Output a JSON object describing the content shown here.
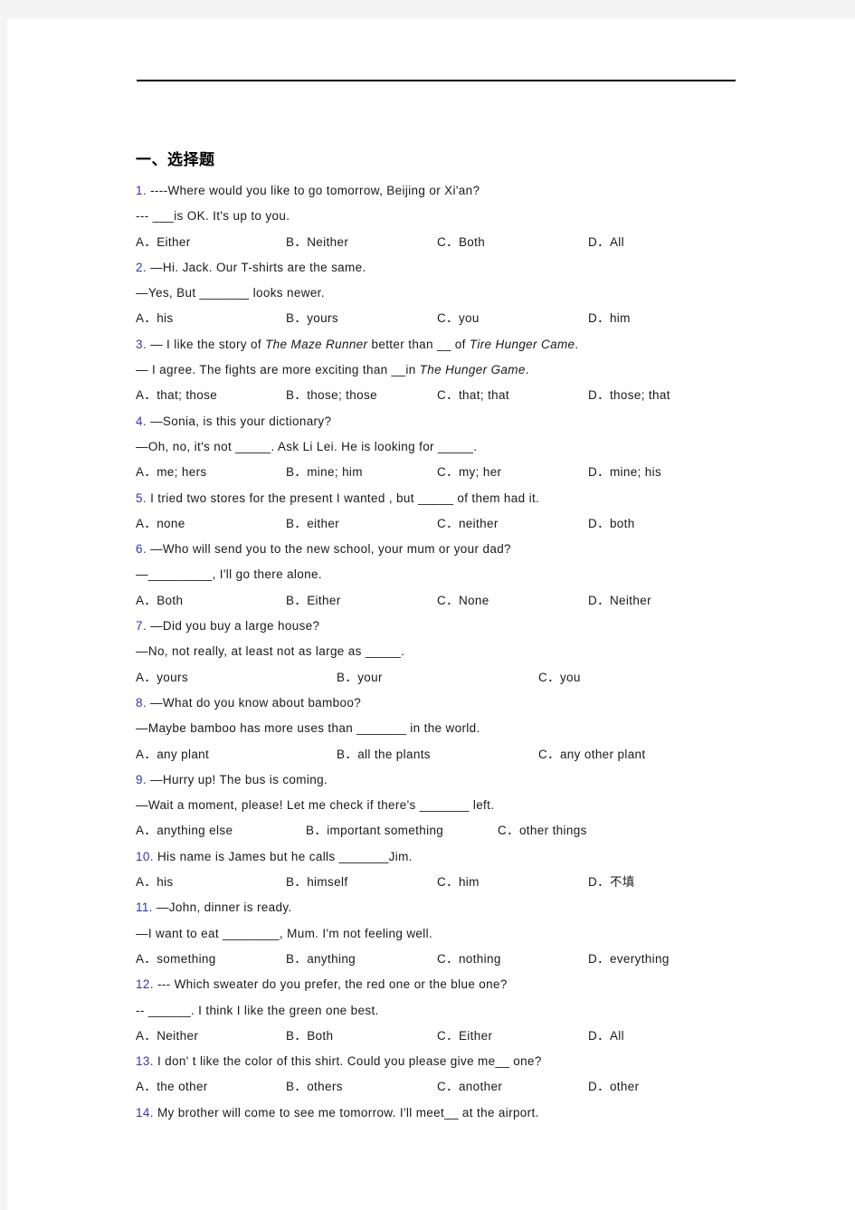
{
  "document": {
    "section_heading": "一、选择题",
    "questions": [
      {
        "num": "1.",
        "lines": [
          "----Where would you like to go tomorrow, Beijing or Xi'an?",
          "--- ___is OK. It's up to you."
        ],
        "options": [
          "A．Either",
          "B．Neither",
          "C．Both",
          "D．All"
        ],
        "layout": "cols4"
      },
      {
        "num": "2.",
        "lines": [
          "—Hi. Jack. Our T-shirts are the same.",
          "—Yes, But _______ looks newer."
        ],
        "options": [
          "A．his",
          "B．yours",
          "C．you",
          "D．him"
        ],
        "layout": "cols4"
      },
      {
        "num": "3.",
        "lines": [
          "— I like the story of The Maze Runner better than  __ of Tire Hunger Came.",
          "— I agree. The fights are more exciting than   __in The Hunger Game."
        ],
        "options": [
          "A．that; those",
          "B．those; those",
          "C．that; that",
          "D．those; that"
        ],
        "layout": "cols4"
      },
      {
        "num": "4.",
        "lines": [
          "—Sonia, is this your dictionary?",
          "—Oh, no, it's not _____. Ask Li Lei. He is looking for _____."
        ],
        "options": [
          "A．me; hers",
          "B．mine; him",
          "C．my; her",
          "D．mine; his"
        ],
        "layout": "cols4"
      },
      {
        "num": "5.",
        "lines": [
          "I tried two stores for the present I wanted , but _____ of them had it."
        ],
        "options": [
          "A．none",
          "B．either",
          "C．neither",
          "D．both"
        ],
        "layout": "cols4"
      },
      {
        "num": "6.",
        "lines": [
          "—Who will send you to the new school, your mum or your dad?",
          "—_________, I'll go there alone."
        ],
        "options": [
          "A．Both",
          "B．Either",
          "C．None",
          "D．Neither"
        ],
        "layout": "cols4"
      },
      {
        "num": "7.",
        "lines": [
          "—Did you buy a large house?",
          "—No, not really, at least not as large as _____."
        ],
        "options": [
          "A．yours",
          "B．your",
          "C．you"
        ],
        "layout": "cols3"
      },
      {
        "num": "8.",
        "lines": [
          "—What do you know about bamboo?",
          "—Maybe bamboo has more uses than _______ in the world."
        ],
        "options": [
          "A．any plant",
          "B．all the plants",
          "C．any other plant"
        ],
        "layout": "cols3"
      },
      {
        "num": "9.",
        "lines": [
          "—Hurry up! The bus is coming.",
          "—Wait a moment, please! Let me check if there's _______ left."
        ],
        "options": [
          "A．anything else",
          "B．important something",
          "C．other things"
        ],
        "layout": "cols3b"
      },
      {
        "num": "10.",
        "lines": [
          "His name is James but he calls _______Jim."
        ],
        "options": [
          "A．his",
          "B．himself",
          "C．him",
          "D．不填"
        ],
        "layout": "cols4"
      },
      {
        "num": "11.",
        "lines": [
          "—John, dinner is ready.",
          "—I want to eat ________, Mum. I'm not feeling well."
        ],
        "options": [
          "A．something",
          "B．anything",
          "C．nothing",
          "D．everything"
        ],
        "layout": "cols4"
      },
      {
        "num": "12.",
        "lines": [
          "--- Which sweater do you prefer, the red one or the blue one?",
          "-- ______. I think I like the green one best."
        ],
        "options": [
          "A．Neither",
          "B．Both",
          "C．Either",
          "D．All"
        ],
        "layout": "cols4"
      },
      {
        "num": "13.",
        "lines": [
          "I don' t like the color of this shirt. Could you please give me__ one?"
        ],
        "options": [
          "A．the other",
          "B．others",
          "C．another",
          "D．other"
        ],
        "layout": "cols4"
      },
      {
        "num": "14.",
        "lines": [
          "My brother will come to see me tomorrow. I'll meet__ at the airport."
        ],
        "options": [],
        "layout": "cols4"
      }
    ]
  }
}
